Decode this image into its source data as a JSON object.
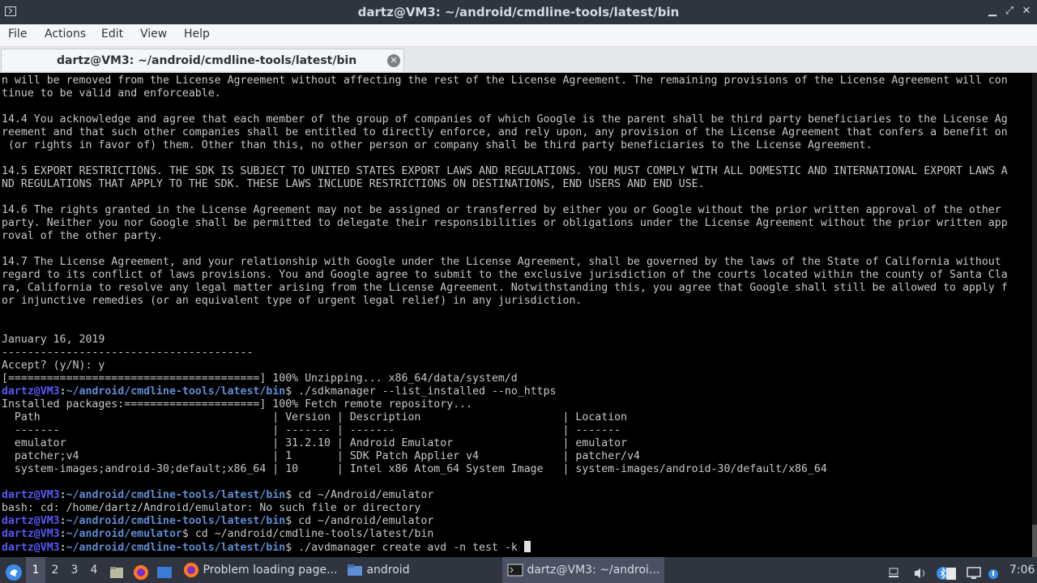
{
  "window": {
    "title": "dartz@VM3: ~/android/cmdline-tools/latest/bin",
    "minimize": "▁",
    "maximize": "⤢",
    "close": "✕"
  },
  "menu": [
    "File",
    "Actions",
    "Edit",
    "View",
    "Help"
  ],
  "tab": {
    "label": "dartz@VM3: ~/android/cmdline-tools/latest/bin",
    "close": "✕"
  },
  "terminal": {
    "lines": [
      {
        "t": "n will be removed from the License Agreement without affecting the rest of the License Agreement. The remaining provisions of the License Agreement will con"
      },
      {
        "t": "tinue to be valid and enforceable."
      },
      {
        "t": ""
      },
      {
        "t": "14.4 You acknowledge and agree that each member of the group of companies of which Google is the parent shall be third party beneficiaries to the License Ag"
      },
      {
        "t": "reement and that such other companies shall be entitled to directly enforce, and rely upon, any provision of the License Agreement that confers a benefit on"
      },
      {
        "t": " (or rights in favor of) them. Other than this, no other person or company shall be third party beneficiaries to the License Agreement."
      },
      {
        "t": ""
      },
      {
        "t": "14.5 EXPORT RESTRICTIONS. THE SDK IS SUBJECT TO UNITED STATES EXPORT LAWS AND REGULATIONS. YOU MUST COMPLY WITH ALL DOMESTIC AND INTERNATIONAL EXPORT LAWS A"
      },
      {
        "t": "ND REGULATIONS THAT APPLY TO THE SDK. THESE LAWS INCLUDE RESTRICTIONS ON DESTINATIONS, END USERS AND END USE."
      },
      {
        "t": ""
      },
      {
        "t": "14.6 The rights granted in the License Agreement may not be assigned or transferred by either you or Google without the prior written approval of the other"
      },
      {
        "t": "party. Neither you nor Google shall be permitted to delegate their responsibilities or obligations under the License Agreement without the prior written app"
      },
      {
        "t": "roval of the other party."
      },
      {
        "t": ""
      },
      {
        "t": "14.7 The License Agreement, and your relationship with Google under the License Agreement, shall be governed by the laws of the State of California without"
      },
      {
        "t": "regard to its conflict of laws provisions. You and Google agree to submit to the exclusive jurisdiction of the courts located within the county of Santa Cla"
      },
      {
        "t": "ra, California to resolve any legal matter arising from the License Agreement. Notwithstanding this, you agree that Google shall still be allowed to apply f"
      },
      {
        "t": "or injunctive remedies (or an equivalent type of urgent legal relief) in any jurisdiction."
      },
      {
        "t": ""
      },
      {
        "t": ""
      },
      {
        "t": "January 16, 2019"
      },
      {
        "t": "---------------------------------------"
      },
      {
        "t": "Accept? (y/N): y"
      },
      {
        "t": "[=======================================] 100% Unzipping... x86_64/data/system/d"
      },
      {
        "user": "dartz@VM3",
        "path": "~/android/cmdline-tools/latest/bin",
        "cmd": " ./sdkmanager --list_installed --no_https"
      },
      {
        "t": "Installed packages:=====================] 100% Fetch remote repository..."
      },
      {
        "t": "  Path                                    | Version | Description                      | Location"
      },
      {
        "t": "  -------                                 | ------- | -------                          | -------"
      },
      {
        "t": "  emulator                                | 31.2.10 | Android Emulator                 | emulator"
      },
      {
        "t": "  patcher;v4                              | 1       | SDK Patch Applier v4             | patcher/v4"
      },
      {
        "t": "  system-images;android-30;default;x86_64 | 10      | Intel x86 Atom_64 System Image   | system-images/android-30/default/x86_64"
      },
      {
        "t": ""
      },
      {
        "user": "dartz@VM3",
        "path": "~/android/cmdline-tools/latest/bin",
        "cmd": " cd ~/Android/emulator"
      },
      {
        "t": "bash: cd: /home/dartz/Android/emulator: No such file or directory"
      },
      {
        "user": "dartz@VM3",
        "path": "~/android/cmdline-tools/latest/bin",
        "cmd": " cd ~/android/emulator"
      },
      {
        "user": "dartz@VM3",
        "path": "~/android/emulator",
        "cmd": " cd ~/android/cmdline-tools/latest/bin"
      },
      {
        "user": "dartz@VM3",
        "path": "~/android/cmdline-tools/latest/bin",
        "cmd": " ./avdmanager create avd -n test -k ",
        "cursor": true
      }
    ]
  },
  "taskbar": {
    "workspaces": [
      "1",
      "2",
      "3",
      "4"
    ],
    "active_workspace": "1",
    "tasks": [
      {
        "label": "Problem loading page...",
        "icon": "firefox-icon"
      },
      {
        "label": "android",
        "icon": "folder-icon"
      },
      {
        "label": "dartz@VM3: ~/androi...",
        "icon": "terminal-icon",
        "active": true
      }
    ],
    "clock": "7:06"
  }
}
